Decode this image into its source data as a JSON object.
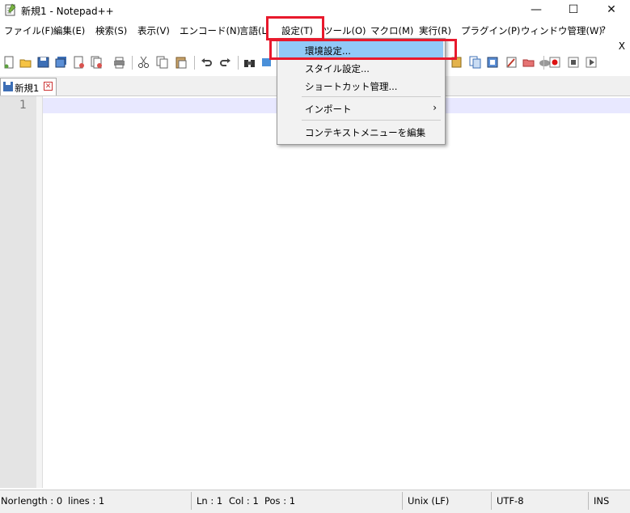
{
  "window": {
    "title": "新規1 - Notepad++",
    "minimize": "—",
    "maximize": "☐",
    "close": "✕"
  },
  "menubar": {
    "items": [
      "ファイル(F)",
      "編集(E)",
      "検索(S)",
      "表示(V)",
      "エンコード(N)",
      "言語(L)",
      "設定(T)",
      "ツール(O)",
      "マクロ(M)",
      "実行(R)",
      "プラグイン(P)",
      "ウィンドウ管理(W)",
      "?"
    ],
    "close_doc": "X"
  },
  "tab": {
    "label": "新規1",
    "close": "✕"
  },
  "editor": {
    "line_number": "1"
  },
  "settings_menu": {
    "items": [
      "環境設定...",
      "スタイル設定...",
      "ショートカット管理...",
      "インポート",
      "コンテキストメニューを編集"
    ],
    "submenu_arrow": "›"
  },
  "statusbar": {
    "type": "Nor",
    "length": "length : 0",
    "lines": "lines : 1",
    "ln": "Ln : 1",
    "col": "Col : 1",
    "pos": "Pos : 1",
    "eol": "Unix (LF)",
    "encoding": "UTF-8",
    "mode": "INS"
  },
  "colors": {
    "highlight_box": "#e8192c",
    "menu_highlight": "#91c9f7",
    "caret_line": "#e8e8ff"
  }
}
